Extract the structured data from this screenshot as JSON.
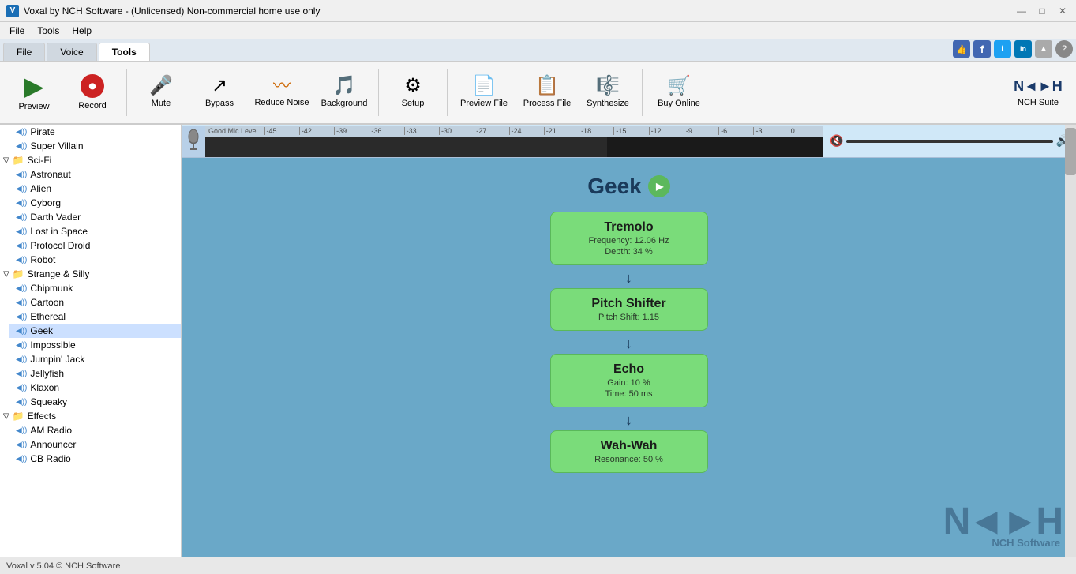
{
  "titlebar": {
    "icon": "V",
    "title": "Voxal by NCH Software - (Unlicensed) Non-commercial home use only"
  },
  "menubar": {
    "items": [
      "File",
      "Tools",
      "Help"
    ]
  },
  "tabs": {
    "items": [
      "File",
      "Voice",
      "Tools"
    ],
    "active": "Tools"
  },
  "toolbar": {
    "buttons": [
      {
        "id": "preview",
        "label": "Preview",
        "icon": "▶"
      },
      {
        "id": "record",
        "label": "Record",
        "icon": "⏺"
      },
      {
        "id": "mute",
        "label": "Mute",
        "icon": "🎤"
      },
      {
        "id": "bypass",
        "label": "Bypass",
        "icon": "↗"
      },
      {
        "id": "reduce-noise",
        "label": "Reduce Noise",
        "icon": "〜"
      },
      {
        "id": "background",
        "label": "Background",
        "icon": "♪"
      },
      {
        "id": "setup",
        "label": "Setup",
        "icon": "⚙"
      },
      {
        "id": "preview-file",
        "label": "Preview File",
        "icon": "📄"
      },
      {
        "id": "process-file",
        "label": "Process File",
        "icon": "📋"
      },
      {
        "id": "synthesize",
        "label": "Synthesize",
        "icon": "🎵"
      },
      {
        "id": "buy-online",
        "label": "Buy Online",
        "icon": "🛒"
      }
    ],
    "nch_suite": "NCH Suite"
  },
  "sidebar": {
    "items": [
      {
        "type": "leaf",
        "label": "Pirate",
        "depth": 1
      },
      {
        "type": "leaf",
        "label": "Super Villain",
        "depth": 1
      },
      {
        "type": "folder",
        "label": "Sci-Fi",
        "depth": 0,
        "open": true
      },
      {
        "type": "leaf",
        "label": "Astronaut",
        "depth": 2
      },
      {
        "type": "leaf",
        "label": "Alien",
        "depth": 2
      },
      {
        "type": "leaf",
        "label": "Cyborg",
        "depth": 2
      },
      {
        "type": "leaf",
        "label": "Darth Vader",
        "depth": 2
      },
      {
        "type": "leaf",
        "label": "Lost in Space",
        "depth": 2
      },
      {
        "type": "leaf",
        "label": "Protocol Droid",
        "depth": 2
      },
      {
        "type": "leaf",
        "label": "Robot",
        "depth": 2
      },
      {
        "type": "folder",
        "label": "Strange & Silly",
        "depth": 0,
        "open": true
      },
      {
        "type": "leaf",
        "label": "Chipmunk",
        "depth": 2
      },
      {
        "type": "leaf",
        "label": "Cartoon",
        "depth": 2
      },
      {
        "type": "leaf",
        "label": "Ethereal",
        "depth": 2
      },
      {
        "type": "leaf",
        "label": "Geek",
        "depth": 2,
        "selected": true
      },
      {
        "type": "leaf",
        "label": "Impossible",
        "depth": 2
      },
      {
        "type": "leaf",
        "label": "Jumpin' Jack",
        "depth": 2
      },
      {
        "type": "leaf",
        "label": "Jellyfish",
        "depth": 2
      },
      {
        "type": "leaf",
        "label": "Klaxon",
        "depth": 2
      },
      {
        "type": "leaf",
        "label": "Squeaky",
        "depth": 2
      },
      {
        "type": "folder",
        "label": "Effects",
        "depth": 0,
        "open": true
      },
      {
        "type": "leaf",
        "label": "AM Radio",
        "depth": 2
      },
      {
        "type": "leaf",
        "label": "Announcer",
        "depth": 2
      },
      {
        "type": "leaf",
        "label": "CB Radio",
        "depth": 2
      }
    ]
  },
  "flow": {
    "voice_label": "Geek",
    "nodes": [
      {
        "title": "Tremolo",
        "details": [
          "Frequency: 12.06 Hz",
          "Depth: 34 %"
        ]
      },
      {
        "title": "Pitch Shifter",
        "details": [
          "Pitch Shift: 1.15"
        ]
      },
      {
        "title": "Echo",
        "details": [
          "Gain: 10 %",
          "Time: 50 ms"
        ]
      },
      {
        "title": "Wah-Wah",
        "details": [
          "Resonance: 50 %"
        ]
      }
    ]
  },
  "ruler": {
    "marks": [
      "-45",
      "-42",
      "-39",
      "-36",
      "-33",
      "-30",
      "-27",
      "-24",
      "-21",
      "-18",
      "-15",
      "-12",
      "-9",
      "-6",
      "-3",
      "0"
    ]
  },
  "good_mic_label": "Good Mic Level",
  "statusbar": {
    "text": "Voxal v 5.04 © NCH Software"
  },
  "watermark": {
    "main": "N◄►H",
    "sub": "NCH Software"
  },
  "social_icons": [
    {
      "label": "👍",
      "color": "#4267B2",
      "title": "like"
    },
    {
      "label": "f",
      "color": "#4267B2",
      "title": "facebook"
    },
    {
      "label": "t",
      "color": "#1DA1F2",
      "title": "twitter"
    },
    {
      "label": "in",
      "color": "#0077B5",
      "title": "linkedin"
    },
    {
      "label": "▲",
      "color": "#888",
      "title": "up"
    },
    {
      "label": "?",
      "color": "#888",
      "title": "help"
    }
  ]
}
